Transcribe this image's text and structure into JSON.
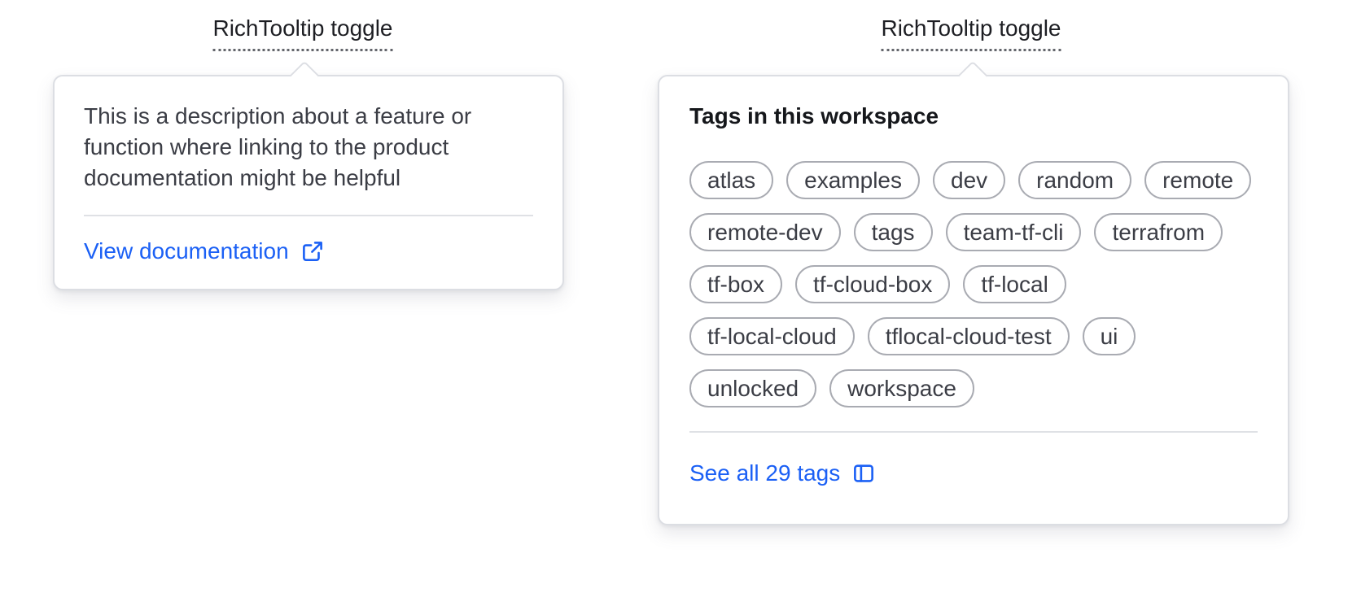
{
  "colors": {
    "link_blue": "#1b60f5",
    "box_border": "#dcdee3",
    "divider": "#dfe1e5",
    "text_primary": "#3b3d45",
    "heading_text": "#15171b",
    "pill_border": "#a9abb2",
    "label_text": "#1d1e23"
  },
  "tooltip_left": {
    "toggle_label": "RichTooltip toggle",
    "description": "This is a description about a feature or function where linking to the product documentation might be helpful",
    "link_label": "View documentation",
    "link_icon": "external-link-icon"
  },
  "tooltip_right": {
    "toggle_label": "RichTooltip toggle",
    "heading": "Tags in this workspace",
    "tags": [
      "atlas",
      "examples",
      "dev",
      "random",
      "remote",
      "remote-dev",
      "tags",
      "team-tf-cli",
      "terrafrom",
      "tf-box",
      "tf-cloud-box",
      "tf-local",
      "tf-local-cloud",
      "tflocal-cloud-test",
      "ui",
      "unlocked",
      "workspace"
    ],
    "link_label": "See all 29 tags",
    "link_icon": "sidebar-icon"
  }
}
